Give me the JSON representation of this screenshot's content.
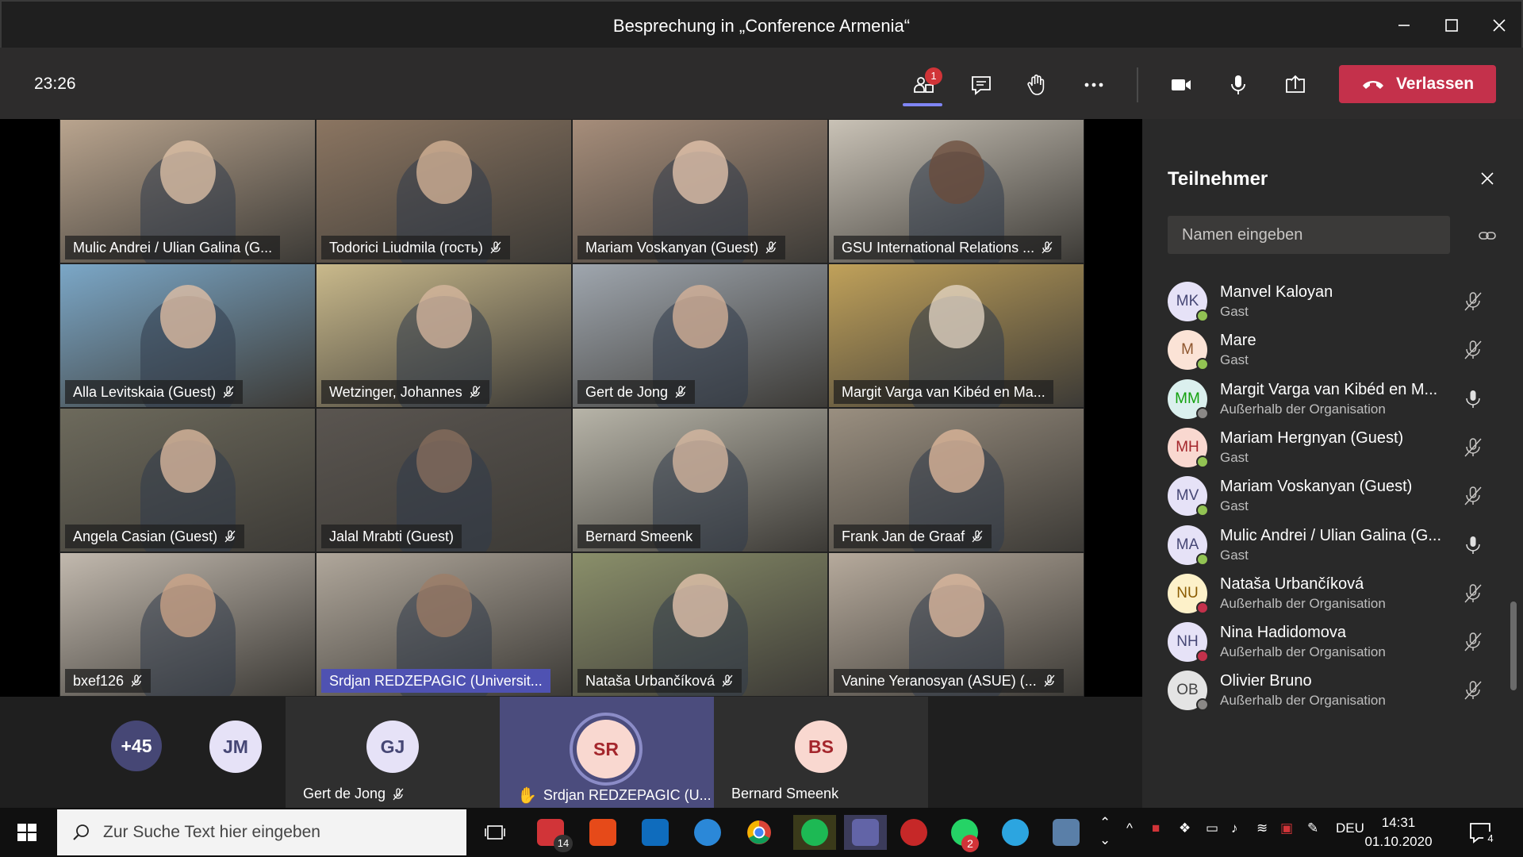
{
  "window": {
    "title": "Besprechung in „Conference Armenia“",
    "minimize_icon": "minimize-icon",
    "maximize_icon": "maximize-icon",
    "close_icon": "close-icon"
  },
  "toolbar": {
    "timer": "23:26",
    "participants_badge": "1",
    "leave_label": "Verlassen",
    "icons": [
      "participants-icon",
      "chat-icon",
      "raise-hand-icon",
      "more-options-icon",
      "camera-icon",
      "microphone-icon",
      "share-screen-icon",
      "hang-up-icon"
    ]
  },
  "video_tiles": [
    {
      "name": "Mulic Andrei / Ulian Galina (G...",
      "muted": false
    },
    {
      "name": "Todorici Liudmila (гость)",
      "muted": true
    },
    {
      "name": "Mariam Voskanyan (Guest)",
      "muted": true
    },
    {
      "name": "GSU International Relations ...",
      "muted": true
    },
    {
      "name": "Alla Levitskaia (Guest)",
      "muted": true
    },
    {
      "name": "Wetzinger, Johannes",
      "muted": true
    },
    {
      "name": "Gert de Jong",
      "muted": true
    },
    {
      "name": "Margit Varga van Kibéd en Ma...",
      "muted": false
    },
    {
      "name": "Angela Casian (Guest)",
      "muted": true
    },
    {
      "name": "Jalal Mrabti (Guest)",
      "muted": false
    },
    {
      "name": "Bernard Smeenk",
      "muted": false
    },
    {
      "name": "Frank Jan de Graaf",
      "muted": true
    },
    {
      "name": "bxef126",
      "muted": true
    },
    {
      "name": "Srdjan REDZEPAGIC (Universit...",
      "muted": false,
      "highlight": true
    },
    {
      "name": "Nataša Urbančíková",
      "muted": true
    },
    {
      "name": "Vanine Yeranosyan (ASUE) (...",
      "muted": true
    }
  ],
  "strip": {
    "overflow": "+45",
    "jm": "JM",
    "gj": {
      "initials": "GJ",
      "name": "Gert de Jong"
    },
    "sr": {
      "initials": "SR",
      "name": "Srdjan REDZEPAGIC (U..."
    },
    "bs": {
      "initials": "BS",
      "name": "Bernard Smeenk"
    }
  },
  "panel": {
    "title": "Teilnehmer",
    "search_placeholder": "Namen eingeben",
    "participants": [
      {
        "initials": "MK",
        "name": "Manvel Kaloyan",
        "sub": "Gast",
        "status": "#92c353",
        "mic": "muted"
      },
      {
        "initials": "M",
        "name": "Mare",
        "sub": "Gast",
        "status": "#92c353",
        "mic": "muted"
      },
      {
        "initials": "MM",
        "name": "Margit Varga van Kibéd en M...",
        "sub": "Außerhalb der Organisation",
        "status": "#8a8886",
        "mic": "on"
      },
      {
        "initials": "MH",
        "name": "Mariam Hergnyan (Guest)",
        "sub": "Gast",
        "status": "#92c353",
        "mic": "muted"
      },
      {
        "initials": "MV",
        "name": "Mariam Voskanyan (Guest)",
        "sub": "Gast",
        "status": "#92c353",
        "mic": "muted"
      },
      {
        "initials": "MA",
        "name": "Mulic Andrei / Ulian Galina (G...",
        "sub": "Gast",
        "status": "#92c353",
        "mic": "on"
      },
      {
        "initials": "NU",
        "name": "Nataša Urbančíková",
        "sub": "Außerhalb der Organisation",
        "status": "#c4314b",
        "mic": "muted"
      },
      {
        "initials": "NH",
        "name": "Nina Hadidomova",
        "sub": "Außerhalb der Organisation",
        "status": "#c4314b",
        "mic": "muted"
      },
      {
        "initials": "OB",
        "name": "Olivier Bruno",
        "sub": "Außerhalb der Organisation",
        "status": "#8a8886",
        "mic": "muted"
      }
    ]
  },
  "taskbar": {
    "search_placeholder": "Zur Suche Text hier eingeben",
    "badge_tasks": "14",
    "badge_whatsapp": "2",
    "badge_notifications": "4",
    "language": "DEU",
    "time": "14:31",
    "date": "01.10.2020"
  },
  "colors": {
    "accent": "#6264a7",
    "leave": "#c4314b",
    "panel_bg": "#292929"
  }
}
